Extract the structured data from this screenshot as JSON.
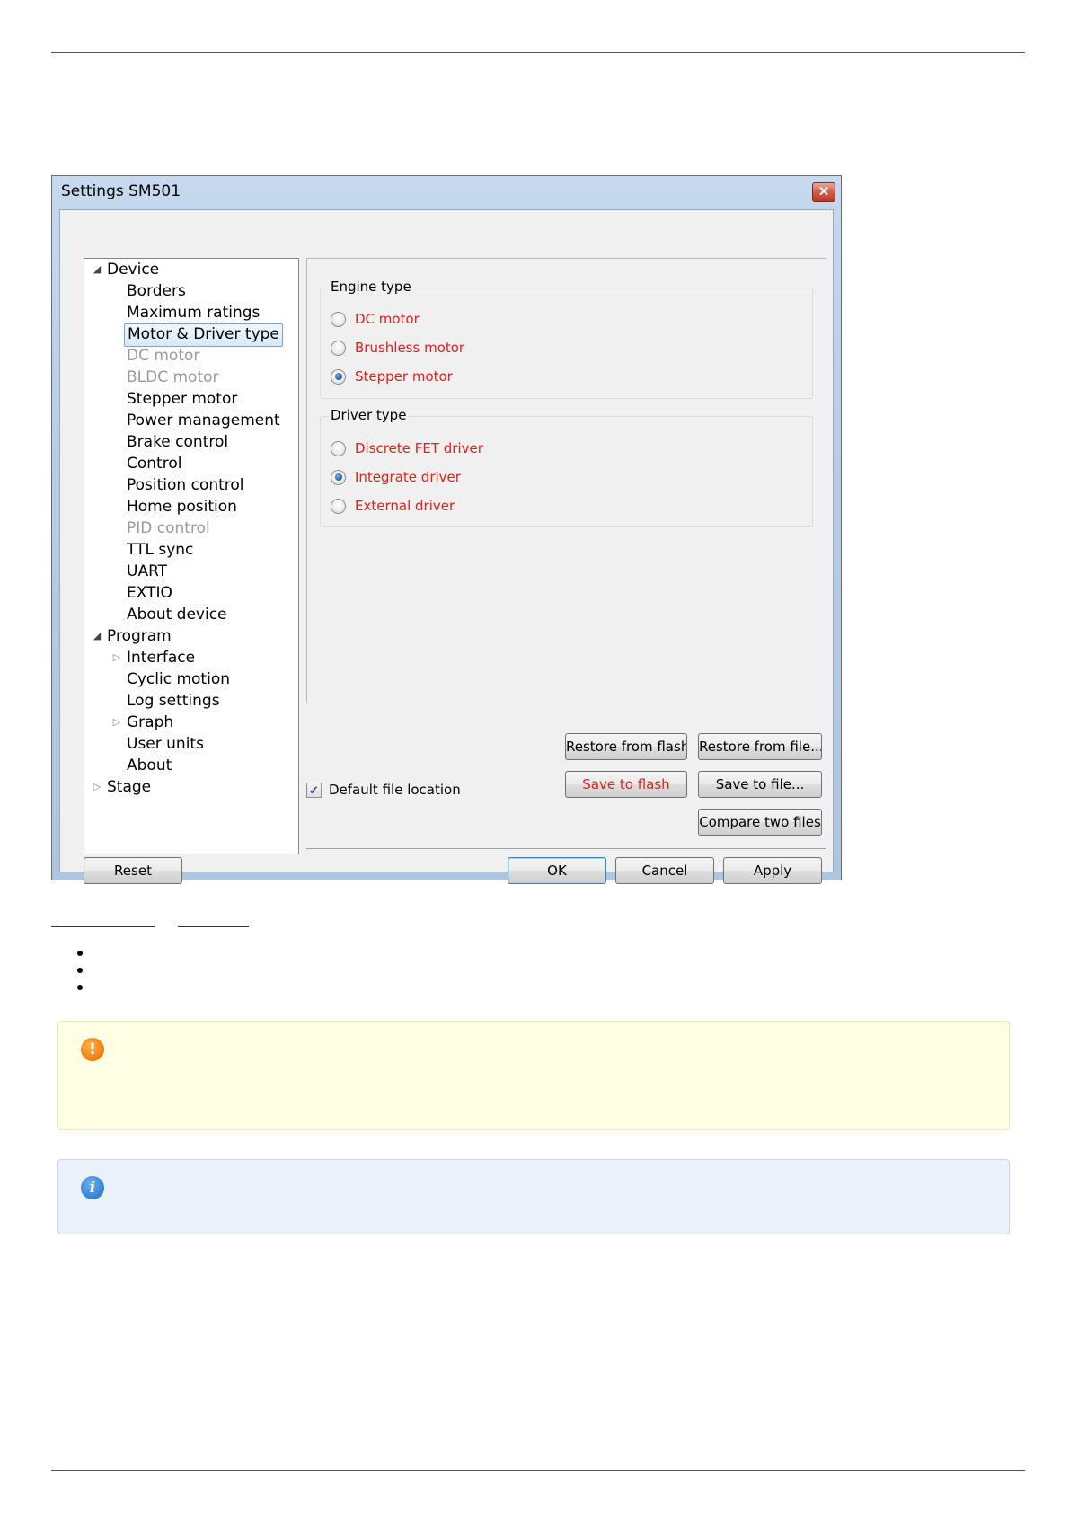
{
  "window": {
    "title": "Settings SM501",
    "close_glyph": "✕"
  },
  "tree": {
    "items": [
      {
        "label": "Device",
        "expander": "◢"
      },
      {
        "label": "Borders"
      },
      {
        "label": "Maximum ratings"
      },
      {
        "label": "Motor & Driver type"
      },
      {
        "label": "DC motor"
      },
      {
        "label": "BLDC motor"
      },
      {
        "label": "Stepper motor"
      },
      {
        "label": "Power management"
      },
      {
        "label": "Brake control"
      },
      {
        "label": "Control"
      },
      {
        "label": "Position control"
      },
      {
        "label": "Home position"
      },
      {
        "label": "PID control"
      },
      {
        "label": "TTL sync"
      },
      {
        "label": "UART"
      },
      {
        "label": "EXTIO"
      },
      {
        "label": "About device"
      },
      {
        "label": "Program",
        "expander": "◢"
      },
      {
        "label": "Interface",
        "expander": "▷"
      },
      {
        "label": "Cyclic motion"
      },
      {
        "label": "Log settings"
      },
      {
        "label": "Graph",
        "expander": "▷"
      },
      {
        "label": "User units"
      },
      {
        "label": "About"
      },
      {
        "label": "Stage",
        "expander": "▷"
      }
    ]
  },
  "engine_type": {
    "title": "Engine type",
    "options": [
      "DC motor",
      "Brushless motor",
      "Stepper motor"
    ],
    "selected": "Stepper motor"
  },
  "driver_type": {
    "title": "Driver type",
    "options": [
      "Discrete FET driver",
      "Integrate driver",
      "External driver"
    ],
    "selected": "Integrate driver"
  },
  "file_buttons": {
    "restore_flash": "Restore from flash",
    "restore_file": "Restore from file...",
    "save_flash": "Save to flash",
    "save_file": "Save to file...",
    "compare": "Compare two files"
  },
  "default_location": {
    "label": "Default file location",
    "checked": true,
    "check_glyph": "✓"
  },
  "dialog_buttons": {
    "reset": "Reset",
    "ok": "OK",
    "cancel": "Cancel",
    "apply": "Apply"
  },
  "notes": {
    "warning_icon_glyph": "!",
    "info_icon_glyph": "i"
  },
  "colors": {
    "option_text": "#e0201b",
    "warning_bg": "#ffffe3",
    "info_bg": "#eaf1fb"
  }
}
